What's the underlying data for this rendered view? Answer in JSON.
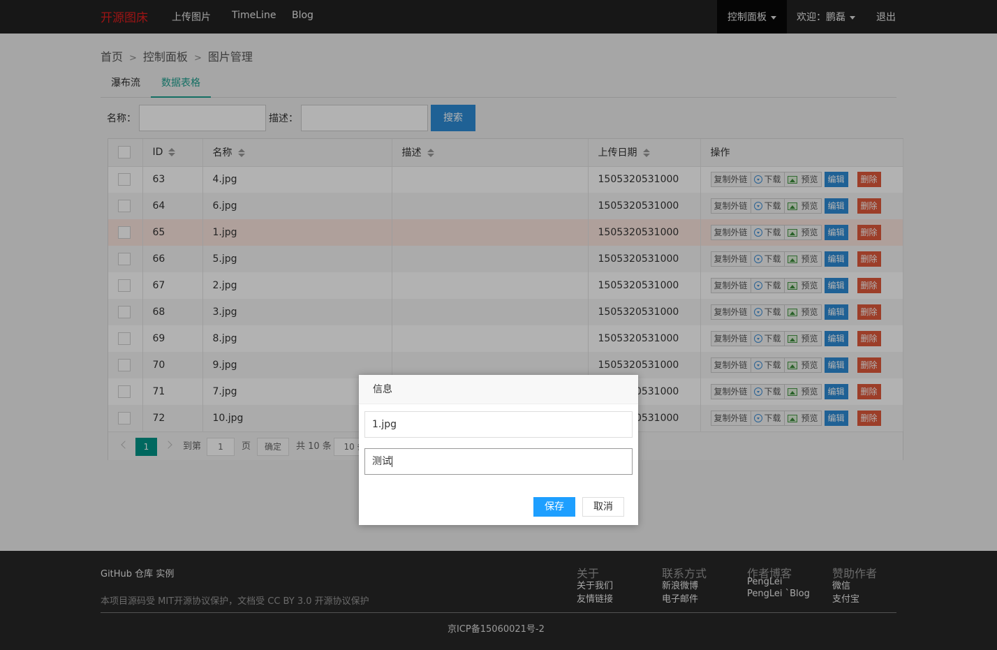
{
  "navbar": {
    "brand": "开源图床",
    "links": [
      "上传图片",
      "TimeLine",
      "Blog"
    ],
    "control_panel": "控制面板",
    "welcome": "欢迎：鹏磊",
    "logout": "退出"
  },
  "breadcrumb": {
    "home": "首页",
    "sep": ">",
    "panel": "控制面板",
    "current": "图片管理"
  },
  "tabs": [
    "瀑布流",
    "数据表格"
  ],
  "search": {
    "name_label": "名称：",
    "desc_label": "描述：",
    "button": "搜索"
  },
  "table": {
    "headers": [
      "ID",
      "名称",
      "描述",
      "上传日期",
      "操作"
    ],
    "rows": [
      {
        "id": "63",
        "name": "4.jpg",
        "desc": "",
        "date": "1505320531000"
      },
      {
        "id": "64",
        "name": "6.jpg",
        "desc": "",
        "date": "1505320531000"
      },
      {
        "id": "65",
        "name": "1.jpg",
        "desc": "",
        "date": "1505320531000"
      },
      {
        "id": "66",
        "name": "5.jpg",
        "desc": "",
        "date": "1505320531000"
      },
      {
        "id": "67",
        "name": "2.jpg",
        "desc": "",
        "date": "1505320531000"
      },
      {
        "id": "68",
        "name": "3.jpg",
        "desc": "",
        "date": "1505320531000"
      },
      {
        "id": "69",
        "name": "8.jpg",
        "desc": "",
        "date": "1505320531000"
      },
      {
        "id": "70",
        "name": "9.jpg",
        "desc": "",
        "date": "1505320531000"
      },
      {
        "id": "71",
        "name": "7.jpg",
        "desc": "",
        "date": "1505320531000"
      },
      {
        "id": "72",
        "name": "10.jpg",
        "desc": "",
        "date": "1505320531000"
      }
    ],
    "actions": {
      "copy": "复制外链",
      "download": "下载",
      "preview": "预览",
      "edit": "编辑",
      "delete": "删除"
    }
  },
  "pager": {
    "current": "1",
    "goto_label": "到第",
    "page_input": "1",
    "page_unit": "页",
    "confirm": "确定",
    "total": "共 10 条",
    "per_page": "10 条"
  },
  "dialog": {
    "title": "信息",
    "name_value": "1.jpg",
    "desc_value": "测试",
    "save": "保存",
    "cancel": "取消"
  },
  "footer": {
    "github_line": "GitHub 仓库 实例",
    "license_line": "本项目源码受 MIT开源协议保护，文档受 CC BY 3.0 开源协议保护",
    "cols": [
      {
        "head": "关于",
        "links": [
          "关于我们",
          "友情链接"
        ]
      },
      {
        "head": "联系方式",
        "links": [
          "新浪微博",
          "电子邮件"
        ]
      },
      {
        "head": "作者博客",
        "links": [
          "PengLei",
          "PengLei `Blog"
        ]
      },
      {
        "head": "赞助作者",
        "links": [
          "微信",
          "支付宝"
        ]
      }
    ],
    "icp": "京ICP备15060021号-2"
  },
  "colors": {
    "accent_teal": "#009688",
    "primary_blue": "#2d8cd6",
    "danger": "#e0593b",
    "brand_red": "#e01d1d"
  }
}
